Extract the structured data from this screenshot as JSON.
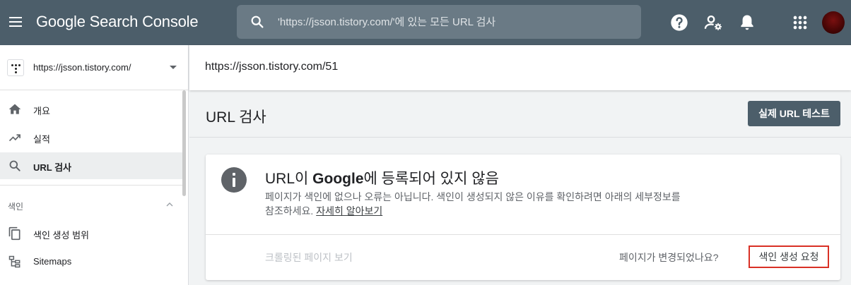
{
  "header": {
    "brand": "Google Search Console",
    "search_placeholder": "'https://jsson.tistory.com/'에 있는 모든 URL 검사"
  },
  "sidebar": {
    "property": "https://jsson.tistory.com/",
    "items": [
      {
        "label": "개요",
        "icon": "home-icon"
      },
      {
        "label": "실적",
        "icon": "trending-up-icon"
      },
      {
        "label": "URL 검사",
        "icon": "search-icon",
        "active": true
      }
    ],
    "section": "색인",
    "section_items": [
      {
        "label": "색인 생성 범위",
        "icon": "copy-pages-icon"
      },
      {
        "label": "Sitemaps",
        "icon": "sitemap-icon"
      }
    ]
  },
  "main": {
    "inspected_url": "https://jsson.tistory.com/51",
    "page_title": "URL 검사",
    "live_test_label": "실제 URL 테스트",
    "card": {
      "title_prefix": "URL",
      "title_mid": "이 ",
      "title_google": "Google",
      "title_suffix": "에 등록되어 있지 않음",
      "desc": "페이지가 색인에 없으나 오류는 아닙니다. 색인이 생성되지 않은 이유를 확인하려면 아래의 세부정보를 참조하세요. ",
      "learn_more": "자세히 알아보기",
      "crawled_label": "크롤링된 페이지 보기",
      "changed_text": "페이지가 변경되었나요?",
      "request_label": "색인 생성 요청"
    }
  },
  "colors": {
    "header_bg": "#4c5e6a",
    "accent_red": "#d93025"
  }
}
